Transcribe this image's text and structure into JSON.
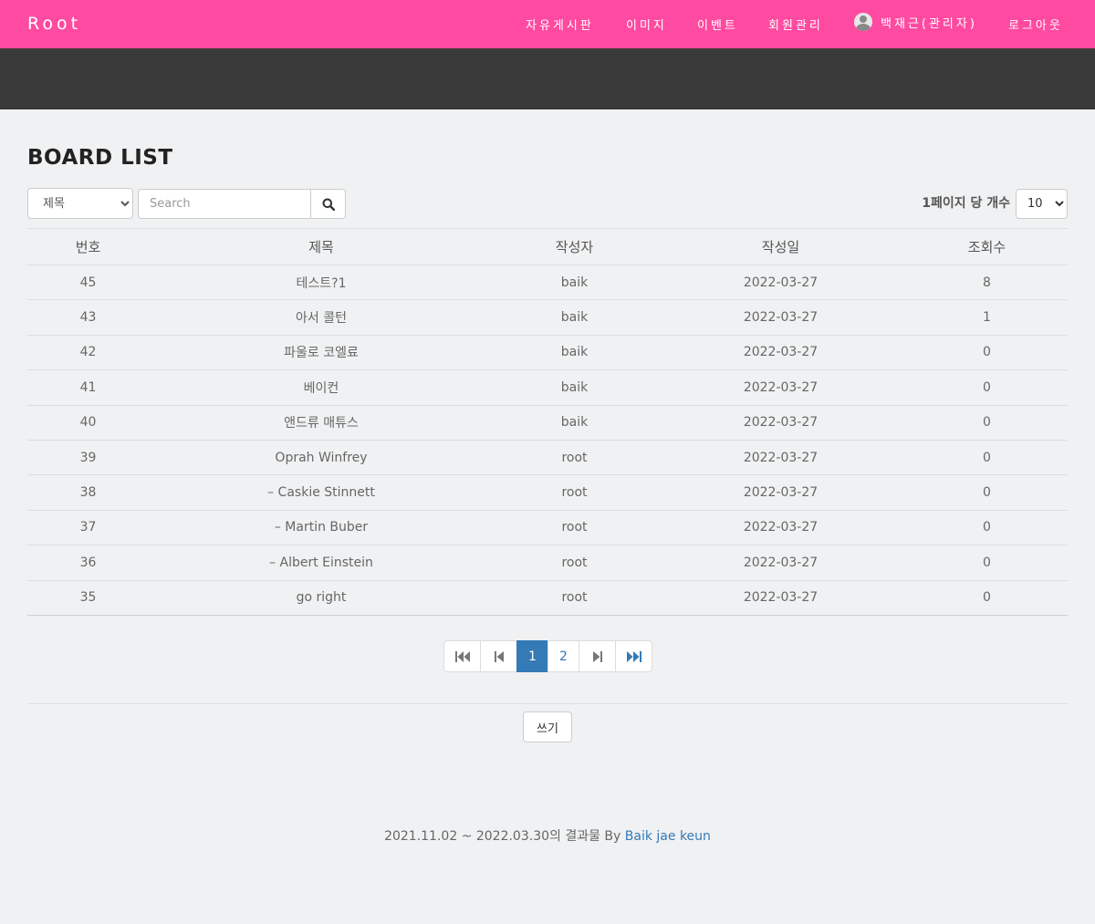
{
  "nav": {
    "brand": "Root",
    "links": [
      "자유게시판",
      "이미지",
      "이벤트",
      "회원관리"
    ],
    "user": "백재근(관리자)",
    "logout": "로그아웃"
  },
  "page": {
    "title": "BOARD LIST"
  },
  "search": {
    "type_selected": "제목",
    "placeholder": "Search",
    "per_page_label": "1페이지 당 개수",
    "per_page_selected": "10"
  },
  "table": {
    "headers": [
      "번호",
      "제목",
      "작성자",
      "작성일",
      "조회수"
    ],
    "rows": [
      [
        "45",
        "테스트?1",
        "baik",
        "2022-03-27",
        "8"
      ],
      [
        "43",
        "아서 콜턴",
        "baik",
        "2022-03-27",
        "1"
      ],
      [
        "42",
        "파울로 코엘료",
        "baik",
        "2022-03-27",
        "0"
      ],
      [
        "41",
        "베이컨",
        "baik",
        "2022-03-27",
        "0"
      ],
      [
        "40",
        "앤드류 매튜스",
        "baik",
        "2022-03-27",
        "0"
      ],
      [
        "39",
        "Oprah Winfrey",
        "root",
        "2022-03-27",
        "0"
      ],
      [
        "38",
        "– Caskie Stinnett",
        "root",
        "2022-03-27",
        "0"
      ],
      [
        "37",
        "– Martin Buber",
        "root",
        "2022-03-27",
        "0"
      ],
      [
        "36",
        "– Albert Einstein",
        "root",
        "2022-03-27",
        "0"
      ],
      [
        "35",
        "go right",
        "root",
        "2022-03-27",
        "0"
      ]
    ]
  },
  "pagination": {
    "pages": [
      "1",
      "2"
    ],
    "current": "1"
  },
  "write_button": "쓰기",
  "footer": {
    "text": "2021.11.02 ~ 2022.03.30의 결과물 By ",
    "author": "Baik jae keun"
  },
  "colors": {
    "nav": "#ff4aa1",
    "banner": "#393939",
    "accent": "#337ab7"
  }
}
